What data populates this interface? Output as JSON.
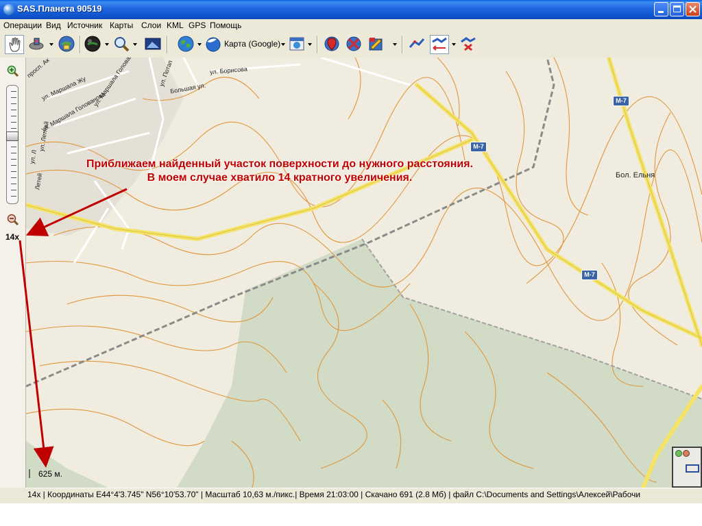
{
  "window": {
    "title": "SAS.Планета 90519"
  },
  "menu": {
    "items": [
      "Операции",
      "Вид",
      "Источник",
      "Карты",
      "Слои",
      "KML",
      "GPS",
      "Помощь"
    ]
  },
  "toolbar": {
    "map_type_label": "Карта (Google)",
    "icons": [
      "hand-move-icon",
      "satellite-dish-icon",
      "globe-download-icon",
      "sphere-icon",
      "magnifier-icon",
      "screen-icon",
      "world-icon",
      "earth-cloud-icon",
      "calendar-map-icon",
      "marker-red-icon",
      "marker-delete-icon",
      "marker-edit-icon",
      "route-icon",
      "distance-icon",
      "area-icon"
    ]
  },
  "zoom_panel": {
    "zoom_level": "14x"
  },
  "map": {
    "labels": {
      "village": "Бол. Ельня",
      "street_marshala_zhukova": "ул. Маршала Жу",
      "street_marshala_golovanova": "ул. Маршала Голованова",
      "street_marshala_golovanova_2": "ул. Маршала Голованова",
      "street_borisova": "ул. Борисова",
      "street_bolshaya": "Большая ул.",
      "street_potap": "ул. Потап",
      "street_prosp": "просп. Ак",
      "street_letnyaya": "ул. Летнай",
      "street_lev": "ул. Л",
      "street_lepel": "Летей"
    },
    "road_badges": [
      "М-7",
      "М-7",
      "М-7"
    ],
    "scale_text": "625 м."
  },
  "annotation": {
    "line1": "Приближаем найденный участок поверхности до нужного расстояния.",
    "line2": "В моем случае хватило 14 кратного увеличения."
  },
  "status_bar": {
    "text": "14x | Координаты E44°4'3.745\" N56°10'53.70\"   | Масштаб 10,63 м./пикс.| Время 21:03:00 | Скачано 691 (2.8 Мб) | файл C:\\Documents and Settings\\Алексей\\Рабочи"
  }
}
